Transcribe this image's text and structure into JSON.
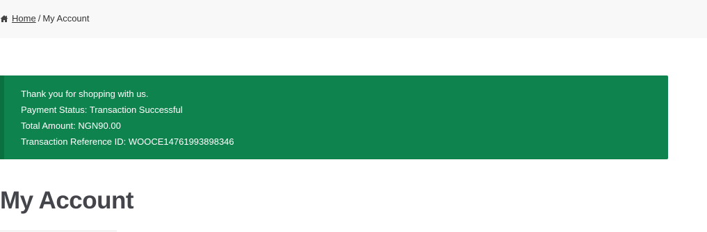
{
  "breadcrumb": {
    "home_label": "Home",
    "separator": "/",
    "current": "My Account"
  },
  "notice": {
    "lines": [
      "Thank you for shopping with us.",
      "Payment Status: Transaction Successful",
      "Total Amount: NGN90.00",
      "Transaction Reference ID: WOOCE14761993898346"
    ],
    "background_color": "#0f834d",
    "accent_color": "#0b703f"
  },
  "page": {
    "title": "My Account"
  },
  "icons": {
    "home": "home-icon"
  }
}
